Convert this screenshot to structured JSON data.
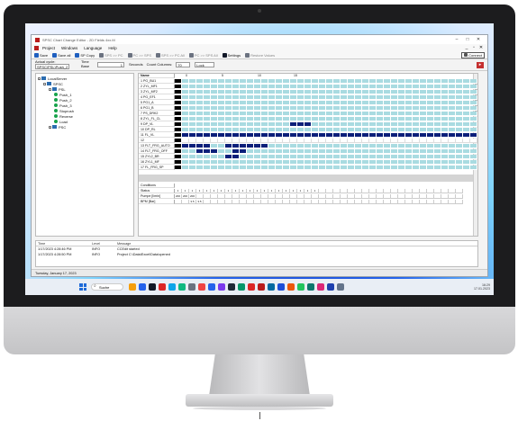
{
  "window": {
    "title": "SPSC Chart Change Editor - 2D Fields 4xx.M",
    "controls": [
      "–",
      "□",
      "✕"
    ]
  },
  "menu": {
    "items": [
      "Project",
      "Windows",
      "Language",
      "Help"
    ],
    "window_controls": [
      "_",
      "▫",
      "✕"
    ]
  },
  "toolbar": {
    "buttons": [
      {
        "label": "Save",
        "color": "#1f5fbf",
        "dim": false
      },
      {
        "label": "Save all",
        "color": "#1f5fbf",
        "dim": false
      },
      {
        "label": "SP Copy",
        "color": "#1f5fbf",
        "dim": false
      },
      {
        "label": "SPS >> PC",
        "color": "#6b7280",
        "dim": true
      },
      {
        "label": "PC >> SPS",
        "color": "#6b7280",
        "dim": true
      },
      {
        "label": "SPS >> PC All",
        "color": "#6b7280",
        "dim": true
      },
      {
        "label": "PC >> SPS All",
        "color": "#6b7280",
        "dim": true
      },
      {
        "label": "Settings",
        "color": "#111827",
        "dim": false
      },
      {
        "label": "Restore Values",
        "color": "#6b7280",
        "dim": true
      }
    ],
    "connect_label": "Connect"
  },
  "subbar": {
    "actual_label": "Actual cycle:",
    "actual_value": "SPSC\\PSL\\Push_2",
    "time_base_label": "Time Base",
    "time_base_value": "1",
    "seconds_label": "Seconds",
    "count_columns_label": "Count Columns:",
    "count_columns_value": "70",
    "lock_value": "Lock",
    "red_button": "▸"
  },
  "tree": [
    {
      "label": "LocalServer",
      "depth": 0,
      "kind": "folder",
      "box": "−"
    },
    {
      "label": "SPSC",
      "depth": 1,
      "kind": "folder",
      "box": "−"
    },
    {
      "label": "PSL",
      "depth": 2,
      "kind": "folder",
      "box": "−"
    },
    {
      "label": "Push_1",
      "depth": 3,
      "kind": "dot",
      "box": ""
    },
    {
      "label": "Push_2",
      "depth": 3,
      "kind": "dot",
      "box": ""
    },
    {
      "label": "Push_3",
      "depth": 3,
      "kind": "dot",
      "box": ""
    },
    {
      "label": "Stoprush",
      "depth": 3,
      "kind": "dot",
      "box": ""
    },
    {
      "label": "Reverse",
      "depth": 3,
      "kind": "dot",
      "box": ""
    },
    {
      "label": "Load",
      "depth": 3,
      "kind": "dot",
      "box": ""
    },
    {
      "label": "PSC",
      "depth": 2,
      "kind": "folder",
      "box": "+"
    }
  ],
  "grid": {
    "header": {
      "name": "Name",
      "ticks": [
        "0",
        "5",
        "10",
        "15"
      ]
    },
    "rows": [
      {
        "name": "1 PG_BU1",
        "fill": "teal",
        "blocks": []
      },
      {
        "name": "2 ZYL_MF1",
        "fill": "teal",
        "blocks": []
      },
      {
        "name": "3 ZYL_MF2",
        "fill": "teal",
        "blocks": []
      },
      {
        "name": "4 PG_EF1",
        "fill": "teal",
        "blocks": []
      },
      {
        "name": "5 PG1_A",
        "fill": "teal",
        "blocks": []
      },
      {
        "name": "6 PG1_B",
        "fill": "teal",
        "blocks": []
      },
      {
        "name": "7 PS_DRK2",
        "fill": "teal",
        "blocks": []
      },
      {
        "name": "8 ZYL_FL_CL",
        "fill": "teal",
        "blocks": []
      },
      {
        "name": "9 DP_VL",
        "fill": "teal",
        "blocks": [
          [
            15,
            17
          ]
        ]
      },
      {
        "name": "10 DP_RL",
        "fill": "teal",
        "blocks": []
      },
      {
        "name": "11 FL_VL",
        "fill": "navy",
        "blocks": [
          [
            0,
            39
          ]
        ]
      },
      {
        "name": "12",
        "fill": "white",
        "blocks": []
      },
      {
        "name": "13 FLT_FRG_AUTO",
        "fill": "teal",
        "blocks": [
          [
            0,
            3
          ],
          [
            6,
            11
          ]
        ]
      },
      {
        "name": "14 FLT_FRG_OFF",
        "fill": "teal",
        "blocks": [
          [
            2,
            4
          ],
          [
            7,
            8
          ]
        ]
      },
      {
        "name": "15 ZYL2_BR",
        "fill": "teal",
        "blocks": [
          [
            6,
            7
          ]
        ]
      },
      {
        "name": "16 ZYL1_MF",
        "fill": "teal",
        "blocks": []
      },
      {
        "name": "17 FL_FRG_SP",
        "fill": "teal",
        "blocks": []
      }
    ],
    "info": {
      "title": "Conditions",
      "rows": [
        {
          "name": "Status",
          "values": [
            "1",
            "1",
            "1",
            "1",
            "1",
            "1",
            "1",
            "1",
            "1",
            "1",
            "1",
            "1",
            "1",
            "1",
            "1",
            "1",
            "1",
            "1",
            "1",
            "1"
          ]
        },
        {
          "name": "Pumpe [l/min]",
          "values": [
            "200",
            "200",
            "200"
          ]
        },
        {
          "name": "BPM [Bar]",
          "values": [
            "",
            "",
            "3.5",
            "3.5"
          ]
        }
      ]
    }
  },
  "log": {
    "columns": [
      "Time",
      "Level",
      "Message"
    ],
    "entries": [
      {
        "time": "1/17/2023 4:28:46 PM",
        "level": "INFO",
        "message": "CCEdit started"
      },
      {
        "time": "1/17/2023 4:28:50 PM",
        "level": "INFO",
        "message": "Project C:\\Data\\Excel\\Data\\opened"
      }
    ]
  },
  "status_bar": "Tuesday, January 17, 2023",
  "taskbar": {
    "search_placeholder": "Suche",
    "apps": [
      "#f59e0b",
      "#2563eb",
      "#111827",
      "#dc2626",
      "#0ea5e9",
      "#10b981",
      "#6b7280",
      "#ef4444",
      "#2563eb",
      "#7c3aed",
      "#1f2937",
      "#059669",
      "#dc2626",
      "#b91c1c",
      "#0369a1",
      "#1d4ed8",
      "#ea580c",
      "#22c55e",
      "#0f766e",
      "#db2777",
      "#1e40af",
      "#64748b"
    ],
    "clock_time": "16:29",
    "clock_date": "17.01.2023"
  },
  "colors": {
    "teal": "#a9dbe1",
    "navy": "#0b1f7a",
    "black": "#000000",
    "accent": "#b91c1c"
  }
}
